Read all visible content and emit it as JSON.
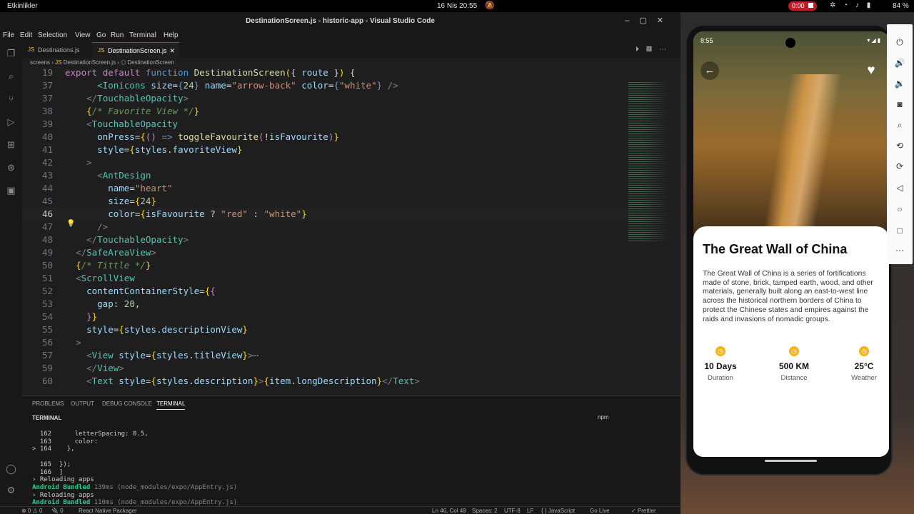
{
  "os": {
    "activities": "Etkinlikler",
    "clock": "16 Nis  20:55",
    "rec_time": "0:00",
    "battery": "84 %"
  },
  "window": {
    "title": "DestinationScreen.js - historic-app - Visual Studio Code"
  },
  "menu": [
    "File",
    "Edit",
    "Selection",
    "View",
    "Go",
    "Run",
    "Terminal",
    "Help"
  ],
  "tabs": [
    {
      "label": "Destinations.js"
    },
    {
      "label": "DestinationScreen.js"
    }
  ],
  "breadcrumb": {
    "folder": "screens",
    "file": "DestinationScreen.js",
    "symbol": "DestinationScreen"
  },
  "editor_lines": [
    {
      "n": "19",
      "html": "<span class='k'>export</span> <span class='k'>default</span> <span class='b'>function</span> <span class='f'>DestinationScreen</span><span class='y'>(</span><span class='o'>{ </span><span class='a'>route</span><span class='o'> }</span><span class='y'>)</span> <span class='o'>{</span>"
    },
    {
      "n": "37",
      "html": "      <span class='t'>&lt;Ionicons</span> <span class='a'>size</span>=<span class='b'>{</span><span class='n'>24</span><span class='b'>}</span> <span class='a'>name</span>=<span class='s'>\"arrow-back\"</span> <span class='a'>color</span>=<span class='b'>{</span><span class='s'>\"white\"</span><span class='b'>}</span> <span class='p'>/&gt;</span>"
    },
    {
      "n": "37",
      "html": "    <span class='p'>&lt;/</span><span class='t'>TouchableOpacity</span><span class='p'>&gt;</span>"
    },
    {
      "n": "38",
      "html": "    <span class='y'>{</span><span class='c'>/* Favorite View */</span><span class='y'>}</span>"
    },
    {
      "n": "39",
      "html": "    <span class='p'>&lt;</span><span class='t'>TouchableOpacity</span>"
    },
    {
      "n": "40",
      "html": "      <span class='a'>onPress</span>=<span class='y'>{</span><span class='k'>()</span> <span class='b'>=&gt;</span> <span class='f'>toggleFavourite</span><span class='k'>(</span>!<span class='a'>isFavourite</span><span class='k'>)</span><span class='y'>}</span>"
    },
    {
      "n": "41",
      "html": "      <span class='a'>style</span>=<span class='y'>{</span><span class='a'>styles</span>.<span class='a'>favoriteView</span><span class='y'>}</span>"
    },
    {
      "n": "42",
      "html": "    <span class='p'>&gt;</span>"
    },
    {
      "n": "43",
      "html": "      <span class='p'>&lt;</span><span class='t'>AntDesign</span>"
    },
    {
      "n": "44",
      "html": "        <span class='a'>name</span>=<span class='s'>\"heart\"</span>"
    },
    {
      "n": "45",
      "html": "        <span class='a'>size</span>=<span class='y'>{</span><span class='n'>24</span><span class='y'>}</span>"
    },
    {
      "n": "46",
      "html": "        <span class='a'>color</span>=<span class='y'>{</span><span class='a'>isFavourite</span> ? <span class='s'>\"red\"</span> : <span class='s'>\"white\"</span><span class='y'>}</span>",
      "cur": true
    },
    {
      "n": "47",
      "html": "      <span class='p'>/&gt;</span>"
    },
    {
      "n": "48",
      "html": "    <span class='p'>&lt;/</span><span class='t'>TouchableOpacity</span><span class='p'>&gt;</span>"
    },
    {
      "n": "49",
      "html": "  <span class='p'>&lt;/</span><span class='t'>SafeAreaView</span><span class='p'>&gt;</span>"
    },
    {
      "n": "50",
      "html": "  <span class='y'>{</span><span class='c'>/* Tittle */</span><span class='y'>}</span>"
    },
    {
      "n": "51",
      "html": "  <span class='p'>&lt;</span><span class='t'>ScrollView</span>"
    },
    {
      "n": "52",
      "html": "    <span class='a'>contentContainerStyle</span>=<span class='y'>{</span><span class='k'>{</span>"
    },
    {
      "n": "53",
      "html": "      <span class='a'>gap</span>: <span class='n'>20</span>,"
    },
    {
      "n": "54",
      "html": "    <span class='k'>}</span><span class='y'>}</span>"
    },
    {
      "n": "55",
      "html": "    <span class='a'>style</span>=<span class='y'>{</span><span class='a'>styles</span>.<span class='a'>descriptionView</span><span class='y'>}</span>"
    },
    {
      "n": "56",
      "html": "  <span class='p'>&gt;</span>"
    },
    {
      "n": "57",
      "html": "    <span class='p'>&lt;</span><span class='t'>View</span> <span class='a'>style</span>=<span class='y'>{</span><span class='a'>styles</span>.<span class='a'>titleView</span><span class='y'>}</span><span class='p'>&gt;</span><span class='p'>⋯</span>"
    },
    {
      "n": "59",
      "html": "    <span class='p'>&lt;/</span><span class='t'>View</span><span class='p'>&gt;</span>"
    },
    {
      "n": "60",
      "html": "    <span class='p'>&lt;</span><span class='t'>Text</span> <span class='a'>style</span>=<span class='y'>{</span><span class='a'>styles</span>.<span class='a'>description</span><span class='y'>}</span><span class='p'>&gt;</span><span class='y'>{</span><span class='a'>item</span>.<span class='a'>longDescription</span><span class='y'>}</span><span class='p'>&lt;/</span><span class='t'>Text</span><span class='p'>&gt;</span>"
    }
  ],
  "panel": {
    "tabs": [
      "PROBLEMS",
      "OUTPUT",
      "DEBUG CONSOLE",
      "TERMINAL"
    ],
    "terminal_header": "TERMINAL",
    "shell": "npm"
  },
  "terminal_lines": [
    "  162      letterSpacing: 0.5,",
    "  163      color:",
    "> 164    },",
    "",
    "  165  });",
    "  166  ]",
    "› Reloading apps",
    "Android Bundled 139ms (node_modules/expo/AppEntry.js)",
    "› Reloading apps",
    "Android Bundled 110ms (node_modules/expo/AppEntry.js)"
  ],
  "statusbar": {
    "errors": "⊗ 0  ⚠ 0",
    "warnings": "🔌 0",
    "packager": "React Native Packager",
    "position": "Ln 46, Col 48",
    "spaces": "Spaces: 2",
    "encoding": "UTF-8",
    "eol": "LF",
    "lang": "{ } JavaScript",
    "golive": "Go Live",
    "prettier": "✓ Prettier"
  },
  "phone": {
    "time": "8:55",
    "title": "The Great Wall of China",
    "description": "The Great Wall of China is a series of fortifications made of stone, brick, tamped earth, wood, and other materials, generally built along an east-to-west line across the historical northern borders of China to protect the Chinese states and empires against the raids and invasions of nomadic groups.",
    "stats": [
      {
        "value": "10 Days",
        "label": "Duration"
      },
      {
        "value": "500 KM",
        "label": "Distance"
      },
      {
        "value": "25°C",
        "label": "Weather"
      }
    ]
  },
  "colors": {
    "accent": "#f4b41a",
    "vscode_bg": "#1e1e1e"
  }
}
